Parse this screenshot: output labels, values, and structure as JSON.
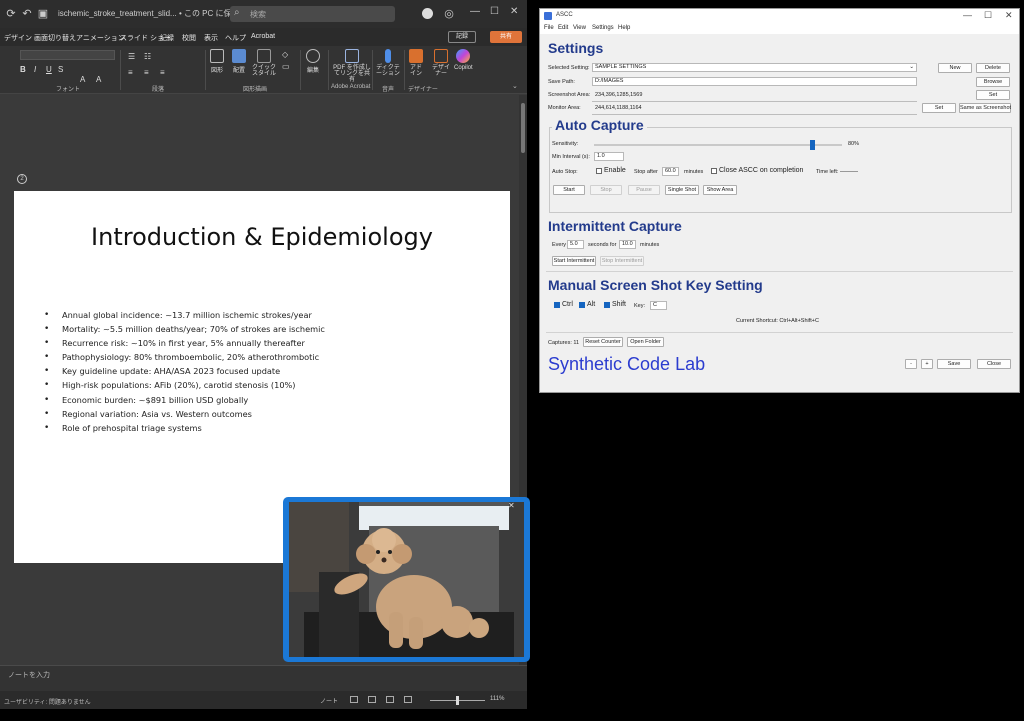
{
  "powerpoint": {
    "filename": "ischemic_stroke_treatment_slid... • この PC に保存済み ~",
    "search_placeholder": "検索",
    "menu_tabs": [
      "デザイン",
      "画面切り替え",
      "アニメーション",
      "スライド ショー",
      "記録",
      "校閲",
      "表示",
      "ヘルプ",
      "Acrobat"
    ],
    "record_label": "記録",
    "share_label": "共有",
    "ribbon": {
      "groups": [
        "フォント",
        "段落",
        "図形描画",
        "Adobe Acrobat",
        "音声",
        "デザイナー"
      ],
      "buttons": {
        "shapes": "図形",
        "arrange": "配置",
        "quick_styles": "クイック スタイル",
        "editing": "編集",
        "create_pdf": "PDF を作成し てリンクを共有",
        "dictate": "ディクテーション",
        "add_in": "アド イン",
        "designer": "デザイナー",
        "copilot": "Copilot"
      }
    },
    "slide": {
      "title": "Introduction & Epidemiology",
      "bullets": [
        "Annual global incidence: ~13.7 million ischemic strokes/year",
        "Mortality: ~5.5 million deaths/year; 70% of strokes are ischemic",
        "Recurrence risk: ~10% in first year, 5% annually thereafter",
        "Pathophysiology: 80% thromboembolic, 20% atherothrombotic",
        "Key guideline update: AHA/ASA 2023 focused update",
        "High-risk populations: AFib (20%), carotid stenosis (10%)",
        "Economic burden: ~$891 billion USD globally",
        "Regional variation: Asia vs. Western outcomes",
        "Role of prehospital triage systems"
      ]
    },
    "notes_placeholder": "ノートを入力",
    "status_text": "ユーザビリティ: 問題ありません",
    "notes_button": "ノート",
    "zoom": "111%"
  },
  "ascc": {
    "window_title": "ASCC",
    "menu": [
      "File",
      "Edit",
      "View",
      "Settings",
      "Help"
    ],
    "settings": {
      "title": "Settings",
      "selected_setting_label": "Selected Setting:",
      "selected_setting_value": "SAMPLE SETTINGS",
      "save_path_label": "Save Path:",
      "save_path_value": "D:/IMAGES",
      "screenshot_area_label": "Screenshot Area:",
      "screenshot_area_value": "234,396,1285,1569",
      "monitor_area_label": "Monitor Area:",
      "monitor_area_value": "244,614,1188,1164",
      "new_label": "New",
      "delete_label": "Delete",
      "browse_label": "Browse",
      "set_label": "Set",
      "same_as_screenshot_label": "Same as Screenshot"
    },
    "auto_capture": {
      "title": "Auto Capture",
      "sensitivity_label": "Sensitivity:",
      "sensitivity_value": "80%",
      "sensitivity_fraction": 0.89,
      "min_interval_label": "Min Interval (s):",
      "min_interval_value": "1.0",
      "auto_stop_label": "Auto Stop:",
      "enable_label": "Enable",
      "stop_after_label": "Stop after",
      "stop_after_value": "60.0",
      "minutes_label": "minutes",
      "close_on_completion_label": "Close ASCC on completion",
      "time_left_label": "Time left:",
      "start_label": "Start",
      "stop_label": "Stop",
      "pause_label": "Pause",
      "single_shot_label": "Single Shot",
      "show_area_label": "Show Area"
    },
    "intermittent": {
      "title": "Intermittent Capture",
      "every_label": "Every",
      "every_value": "5.0",
      "seconds_for_label": "seconds for",
      "for_value": "10.0",
      "minutes_label": "minutes",
      "start_label": "Start Intermittent",
      "stop_label": "Stop Intermittent"
    },
    "manual_key": {
      "title": "Manual Screen Shot Key Setting",
      "ctrl_label": "Ctrl",
      "alt_label": "Alt",
      "shift_label": "Shift",
      "key_label": "Key:",
      "key_value": "C",
      "current_shortcut": "Current Shortcut: Ctrl+Alt+Shift+C"
    },
    "captures_label": "Captures: 11",
    "reset_counter_label": "Reset Counter",
    "open_folder_label": "Open Folder",
    "brand": "Synthetic Code Lab",
    "minus_label": "-",
    "plus_label": "+",
    "save_label": "Save",
    "close_label": "Close"
  }
}
